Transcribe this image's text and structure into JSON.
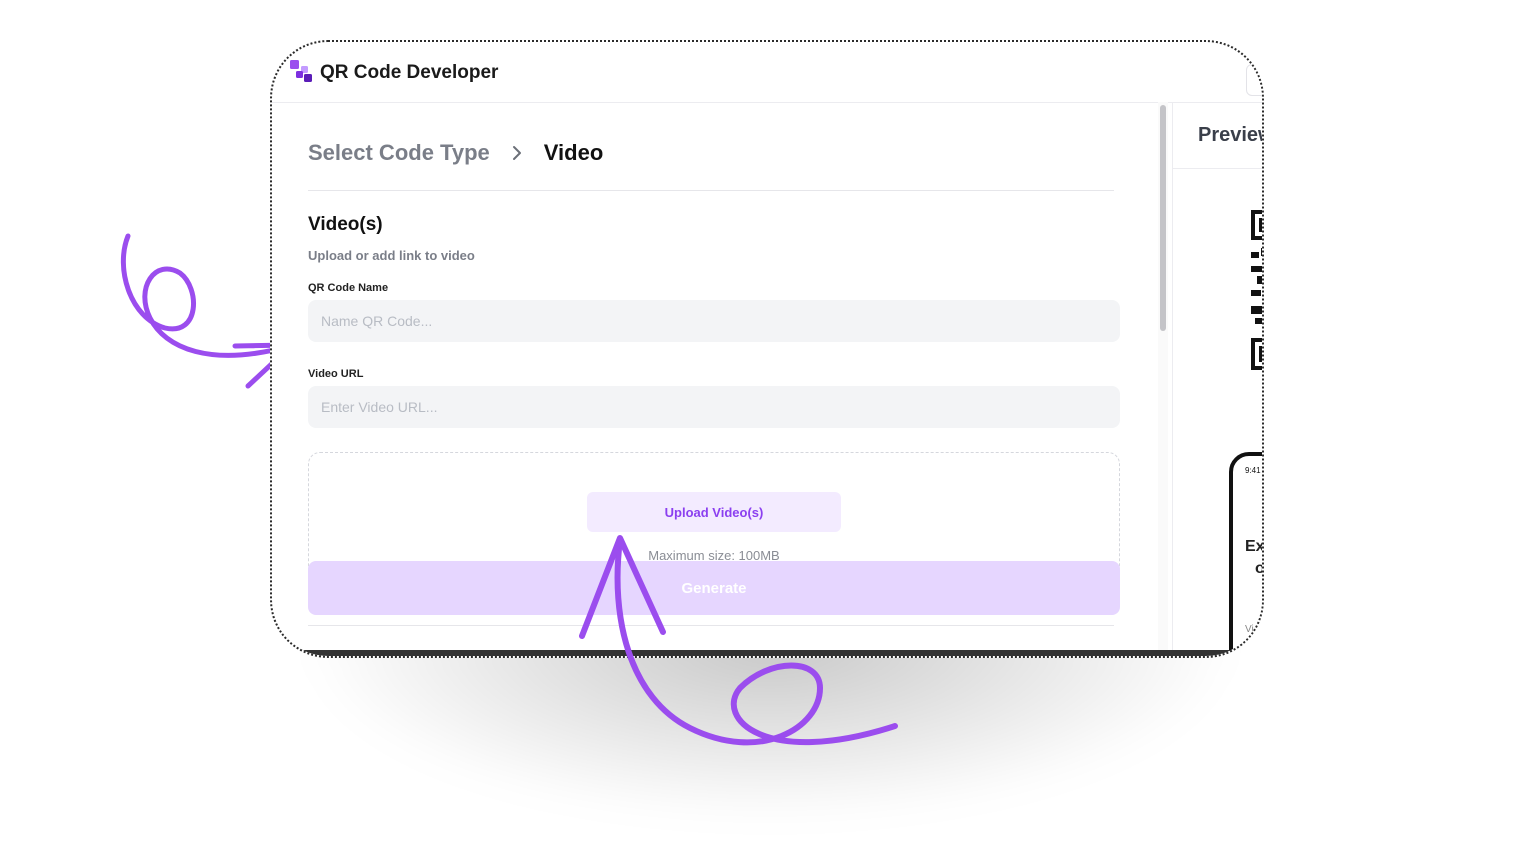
{
  "app": {
    "title": "QR Code Developer"
  },
  "breadcrumb": {
    "parent": "Select Code Type",
    "current": "Video"
  },
  "section": {
    "title": "Video(s)",
    "subtitle": "Upload or add link to video"
  },
  "fields": {
    "name": {
      "label": "QR Code Name",
      "placeholder": "Name QR Code..."
    },
    "url": {
      "label": "Video URL",
      "placeholder": "Enter Video URL..."
    }
  },
  "upload": {
    "button_label": "Upload Video(s)",
    "max_size": "Maximum size: 100MB"
  },
  "generate": {
    "label": "Generate"
  },
  "preview": {
    "title": "Preview",
    "phone": {
      "time": "9:41",
      "text_line1": "Ex",
      "text_line2": "of",
      "text_sub": "Vi"
    }
  },
  "colors": {
    "accent": "#8b3ff0",
    "accent_light": "#f3ebff",
    "generate_disabled": "#e6d6ff",
    "field_bg": "#f3f4f6",
    "arrow": "#9b4dee"
  },
  "icons": {
    "logo": "qr-code-logo-icon",
    "breadcrumb_separator": "chevron-right-icon",
    "left_arrow": "hand-drawn-arrow-icon",
    "bottom_arrow": "hand-drawn-arrow-icon"
  }
}
